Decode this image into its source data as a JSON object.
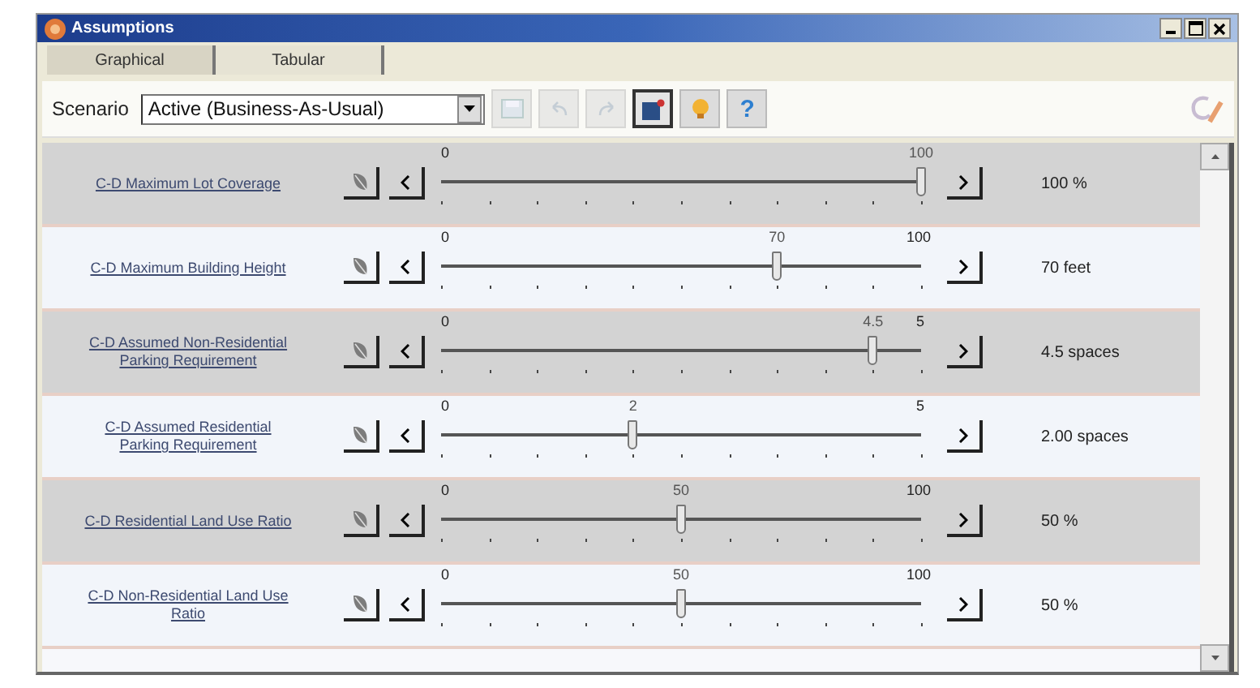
{
  "window": {
    "title": "Assumptions"
  },
  "tabs": [
    {
      "label": "Graphical",
      "selected": true
    },
    {
      "label": "Tabular",
      "selected": false
    }
  ],
  "toolbar": {
    "scenario_label": "Scenario",
    "scenario": "Active (Business-As-Usual)",
    "buttons": [
      {
        "kind": "save",
        "disabled": true,
        "pressed": false
      },
      {
        "kind": "undo",
        "disabled": true,
        "pressed": false
      },
      {
        "kind": "redo",
        "disabled": true,
        "pressed": false
      },
      {
        "kind": "note",
        "disabled": false,
        "pressed": true
      },
      {
        "kind": "bulb",
        "disabled": false,
        "pressed": false
      },
      {
        "kind": "help",
        "label": "?",
        "disabled": false,
        "pressed": false
      }
    ]
  },
  "assumptions": [
    {
      "name": "C-D Maximum Lot Coverage",
      "min": "0",
      "thumb_label": "100",
      "level": 1,
      "value": "100 %"
    },
    {
      "name": "C-D Maximum Building Height",
      "min": "0",
      "max": "100",
      "thumb_label": "70",
      "level": 0.7,
      "value": "70 feet"
    },
    {
      "name": "C-D Assumed Non-Residential Parking Requirement",
      "min": "0",
      "max": "5",
      "thumb_label": "4.5",
      "level": 0.9,
      "value": "4.5 spaces"
    },
    {
      "name": "C-D Assumed Residential Parking Requirement",
      "min": "0",
      "max": "5",
      "thumb_label": "2",
      "level": 0.4,
      "value": "2.00 spaces"
    },
    {
      "name": "C-D Residential Land Use Ratio",
      "min": "0",
      "max": "100",
      "thumb_label": "50",
      "level": 0.5,
      "value": "50 %"
    },
    {
      "name": "C-D Non-Residential Land Use Ratio",
      "min": "0",
      "max": "100",
      "thumb_label": "50",
      "level": 0.5,
      "value": "50 %"
    }
  ]
}
